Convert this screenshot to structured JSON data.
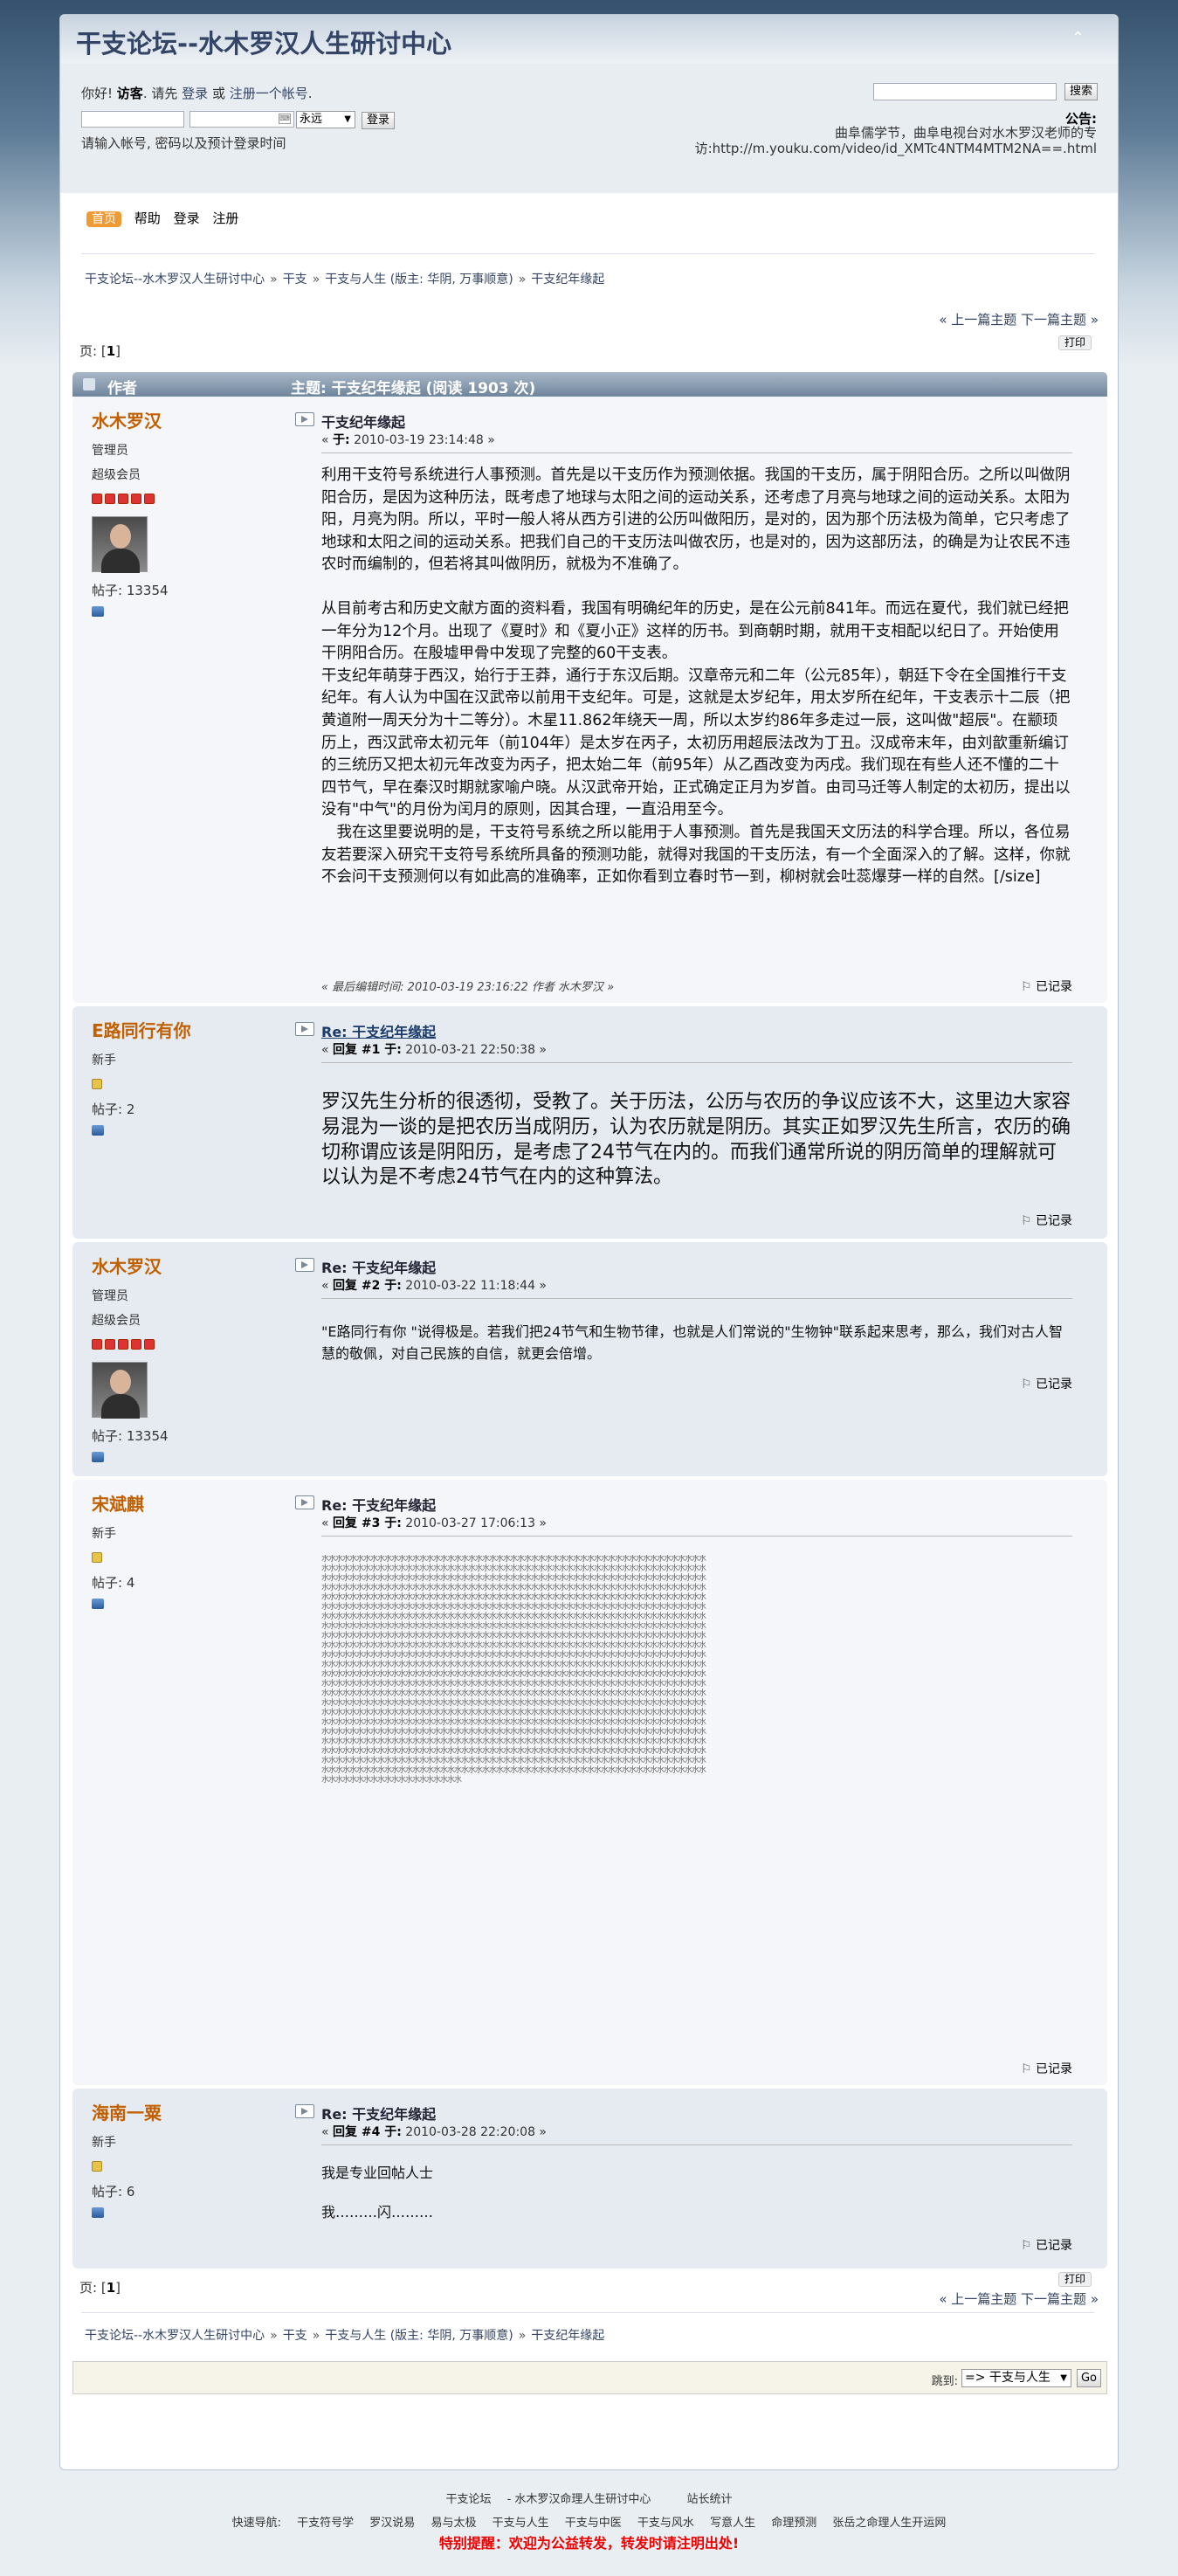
{
  "header": {
    "forum_title": "干支论坛--水木罗汉人生研讨中心"
  },
  "userbox": {
    "greet_prefix": "你好!",
    "guest": "访客",
    "greet_mid": ". 请先",
    "login": "登录",
    "or": "或",
    "register": "注册一个帐号",
    "duration": "永远",
    "login_btn": "登录",
    "hint": "请输入帐号, 密码以及预计登录时间",
    "search_btn": "搜索",
    "notice_label": "公告:",
    "notice_text": "曲阜儒学节，曲阜电视台对水木罗汉老师的专访:http://m.youku.com/video/id_XMTc4NTM4MTM2NA==.html"
  },
  "menu": {
    "home": "首页",
    "help": "帮助",
    "login": "登录",
    "register": "注册"
  },
  "breadcrumb": [
    "干支论坛--水木罗汉人生研讨中心",
    "干支",
    "干支与人生 (版主: 华阴, 万事顺意)",
    "干支纪年缘起"
  ],
  "nav": {
    "prev": "« 上一篇主题",
    "next": "下一篇主题 »",
    "pages_label": "页:",
    "page": "1",
    "print": "打印"
  },
  "topic_bar": {
    "author": "作者",
    "subject": "主题: 干支纪年缘起  (阅读 1903 次)"
  },
  "posts": [
    {
      "name": "水木罗汉",
      "rank": "管理员",
      "group": "超级会员",
      "count": "帖子: 13354",
      "title": "干支纪年缘起",
      "meta_prefix": "« ",
      "meta_label": "于:",
      "meta_time": " 2010-03-19 23:14:48 »",
      "paragraphs": [
        "利用干支符号系统进行人事预测。首先是以干支历作为预测依据。我国的干支历，属于阴阳合历。之所以叫做阴阳合历，是因为这种历法，既考虑了地球与太阳之间的运动关系，还考虑了月亮与地球之间的运动关系。太阳为阳，月亮为阴。所以，平时一般人将从西方引进的公历叫做阳历，是对的，因为那个历法极为简单，它只考虑了地球和太阳之间的运动关系。把我们自己的干支历法叫做农历，也是对的，因为这部历法，的确是为让农民不违农时而编制的，但若将其叫做阴历，就极为不准确了。",
        "从目前考古和历史文献方面的资料看，我国有明确纪年的历史，是在公元前841年。而远在夏代，我们就已经把一年分为12个月。出现了《夏时》和《夏小正》这样的历书。到商朝时期，就用干支相配以纪日了。开始使用干阴阳合历。在殷墟甲骨中发现了完整的60干支表。",
        "干支纪年萌芽于西汉，始行于王莽，通行于东汉后期。汉章帝元和二年（公元85年），朝廷下令在全国推行干支纪年。有人认为中国在汉武帝以前用干支纪年。可是，这就是太岁纪年，用太岁所在纪年，干支表示十二辰（把黄道附一周天分为十二等分）。木星11.862年绕天一周，所以太岁约86年多走过一辰，这叫做\"超辰\"。在颛顼历上，西汉武帝太初元年（前104年）是太岁在丙子，太初历用超辰法改为丁丑。汉成帝末年，由刘歆重新编订的三统历又把太初元年改变为丙子，把太始二年（前95年）从乙酉改变为丙戌。我们现在有些人还不懂的二十四节气，早在秦汉时期就家喻户晓。从汉武帝开始，正式确定正月为岁首。由司马迁等人制定的太初历，提出以没有\"中气\"的月份为闰月的原则，因其合理，一直沿用至今。",
        "　我在这里要说明的是，干支符号系统之所以能用于人事预测。首先是我国天文历法的科学合理。所以，各位易友若要深入研究干支符号系统所具备的预测功能，就得对我国的干支历法，有一个全面深入的了解。这样，你就不会问干支预测何以有如此高的准确率，正如你看到立春时节一到，柳树就会吐蕊爆芽一样的自然。[/size]"
      ],
      "edited_prefix": "« 最后编辑时间:",
      "edited": " 2010-03-19 23:16:22 作者 水木罗汉 »",
      "report": "已记录"
    },
    {
      "name": "E路同行有你",
      "rank": "新手",
      "count": "帖子: 2",
      "title": "Re: 干支纪年缘起",
      "meta_prefix": "« ",
      "meta_label": "回复 #1 于:",
      "meta_time": " 2010-03-21 22:50:38 »",
      "paragraphs": [
        "罗汉先生分析的很透彻，受教了。关于历法，公历与农历的争议应该不大，这里边大家容易混为一谈的是把农历当成阴历，认为农历就是阴历。其实正如罗汉先生所言，农历的确切称谓应该是阴阳历，是考虑了24节气在内的。而我们通常所说的阴历简单的理解就可以认为是不考虑24节气在内的这种算法。"
      ],
      "report": "已记录"
    },
    {
      "name": "水木罗汉",
      "rank": "管理员",
      "group": "超级会员",
      "count": "帖子: 13354",
      "title": "Re: 干支纪年缘起",
      "meta_prefix": "« ",
      "meta_label": "回复 #2 于:",
      "meta_time": " 2010-03-22 11:18:44 »",
      "paragraphs": [
        "\"E路同行有你 \"说得极是。若我们把24节气和生物节律，也就是人们常说的\"生物钟\"联系起来思考，那么，我们对古人智慧的敬佩，对自己民族的自信，就更会倍增。"
      ],
      "report": "已记录"
    },
    {
      "name": "宋斌麒",
      "rank": "新手",
      "count": "帖子: 4",
      "title": "Re: 干支纪年缘起",
      "meta_prefix": "« ",
      "meta_label": "回复 #3 于:",
      "meta_time": " 2010-03-27 17:06:13 »",
      "garbled": "水水水水水水水水水水水水水水水水水水水水水水水水水水水水水水水水水水水水水水水水水水水水水水水水水水水水水水水水水水水水水水水水水水水水水水水水水水水水水水水水水水水水水水水水水水水水水水水水水水水水水水水水水水水水水水水水水水水水水水水水水水水水水水水水水水水水水水水水水水水水水水水水水水水水水水水水水水水水水水水水水水水水水水水水水水水水水水水水水水水水水水水水水水水水水水水水水水水水水水水水水水水水水水水水水水水水水水水水水水水水水水水水水水水水水水水水水水水水水水水水水水水水水水水水水水水水水水水水水水水水水水水水水水水水水水水水水水水水水水水水水水水水水水水水水水水水水水水水水水水水水水水水水水水水水水水水水水水水水水水水水水水水水水水水水水水水水水水水水水水水水水水水水水水水水水水水水水水水水水水水水水水水水水水水水水水水水水水水水水水水水水水水水水水水水水水水水水水水水水水水水水水水水水水水水水水水水水水水水水水水水水水水水水水水水水水水水水水水水水水水水水水水水水水水水水水水水水水水水水水水水水水水水水水水水水水水水水水水水水水水水水水水水水水水水水水水水水水水水水水水水水水水水水水水水水水水水水水水水水水水水水水水水水水水水水水水水水水水水水水水水水水水水水水水水水水水水水水水水水水水水水水水水水水水水水水水水水水水水水水水水水水水水水水水水水水水水水水水水水水水水水水水水水水水水水水水水水水水水水水水水水水水水水水水水水水水水水水水水水水水水水水水水水水水水水水水水水水水水水水水水水水水水水水水水水水水水水水水水水水水水水水水水水水水水水水水水水水水水水水水水水水水水水水水水水水水水水水水水水水水水水水水水水水水水水水水水水水水水水水水水水水水水水水水水水水水水水水水水水水水水水水水水水水水水水水水水水水水水水水水水水水水水水水水水水水水水水水水水水水水水水水水水水水水水水水水水水水水水水水水水水水水水水水水水水水水水水水水水水水水水水水水水水水水水水水水水水水水水水水水水水水水水水水水水水水水水水水水水水水水水水水水水水水水水水水水水水水水水水水水水水水水水水水水水水水水水水水水水水水水水水水水水水水水水水水水水水水水水水水水水水水水水水水水水水水水水水水水水水水水水水水水水水水水水水水水水水水水水水水水水水水水水水水水水水水水水水水水水水水水水水水水水水水水水水水水水水水水水水水水水水水水水水水水水水水水水水水水水水水水水水水水水水水水水水水水水水水水水水水水水水水水水水水水水水水水水水水水水水水水水水水水水水水水水水水水水水水水水水水水水水水水水水水水水水水水水水水水水水水水水水水水水水水水水水水水水水水水水水水水水水水水水水水水水水水水水水水水水水水水水水水水水水水水水水水水水水水水水水水水水水水水水水水水水水水水水水水水水水水水水水水水水水水水水水水水水水水水水水水水水水水水水水水水水水水水水水水水水水水水水水水水水水水水水水水水水水水水水水水水水水水水水水水水水水水水水水水水水水水水水水水水水",
      "report": "已记录"
    },
    {
      "name": "海南一粟",
      "rank": "新手",
      "count": "帖子: 6",
      "title": "Re: 干支纪年缘起",
      "meta_prefix": "« ",
      "meta_label": "回复 #4 于:",
      "meta_time": " 2010-03-28 22:20:08 »",
      "paragraphs": [
        "我是专业回帖人士",
        "我………闪………"
      ],
      "report": "已记录"
    }
  ],
  "jump": {
    "label": "跳到:",
    "selected": "=> 干支与人生",
    "go": "Go"
  },
  "footer": {
    "line1": [
      "干支论坛 ",
      "- 水木罗汉命理人生研讨中心",
      "站长统计"
    ],
    "quick_label": "快速导航:",
    "quick_links": [
      "干支符号学",
      "罗汉说易",
      "易与太极",
      "干支与人生",
      "干支与中医",
      "干支与风水",
      "写意人生",
      "命理预测",
      "张岳之命理人生开运网"
    ],
    "warning": "特别提醒：欢迎为公益转发，转发时请注明出处!"
  }
}
